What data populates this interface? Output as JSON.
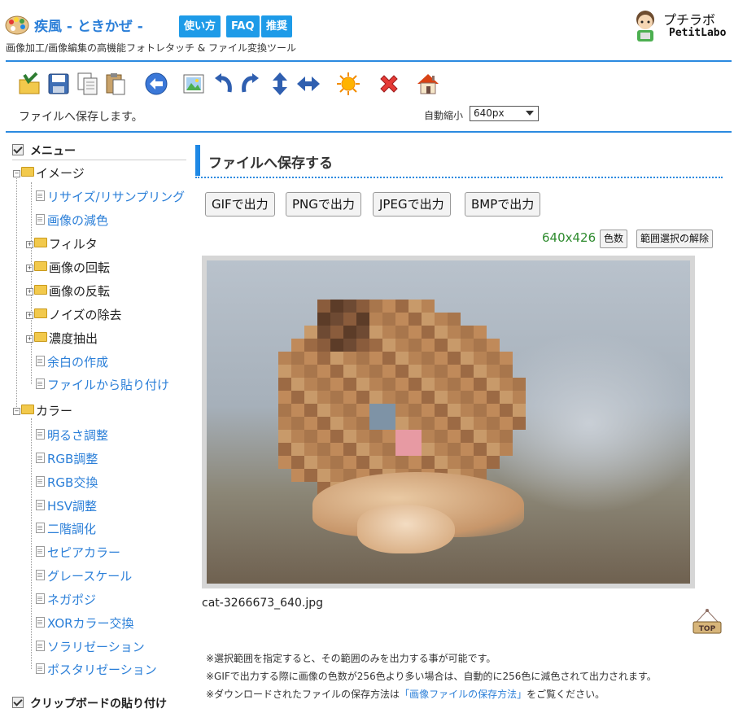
{
  "header": {
    "title": "疾風 - ときかぜ -",
    "buttons": [
      "使い方",
      "FAQ",
      "推奨"
    ],
    "subtitle": "画像加工/画像編集の高機能フォトレタッチ & ファイル変換ツール",
    "brand_line1": "プチラボ",
    "brand_line2": "PetitLabo"
  },
  "toolbar": {
    "icons": [
      "open-file-icon",
      "save-disk-icon",
      "copy-icon",
      "paste-icon",
      "back-arrow-icon",
      "image-icon",
      "rotate-left-icon",
      "rotate-right-icon",
      "flip-vertical-icon",
      "flip-horizontal-icon",
      "sun-icon",
      "delete-x-icon",
      "home-icon"
    ],
    "status": "ファイルへ保存します。",
    "shrink_label": "自動縮小",
    "shrink_value": "640px"
  },
  "sidebar": {
    "menu_title": "メニュー",
    "image_folder": "イメージ",
    "image_items": {
      "resize": "リサイズ/リサンプリング",
      "reduce": "画像の減色",
      "filter": "フィルタ",
      "rotate": "画像の回転",
      "flip": "画像の反転",
      "noise": "ノイズの除去",
      "density": "濃度抽出",
      "margin": "余白の作成",
      "paste_file": "ファイルから貼り付け"
    },
    "color_folder": "カラー",
    "color_items": [
      "明るさ調整",
      "RGB調整",
      "RGB交換",
      "HSV調整",
      "二階調化",
      "セピアカラー",
      "グレースケール",
      "ネガポジ",
      "XORカラー交換",
      "ソラリゼーション",
      "ポスタリゼーション"
    ],
    "clipboard_title": "クリップボードの貼り付け"
  },
  "main": {
    "section_title": "ファイルへ保存する",
    "output_buttons": [
      "GIFで出力",
      "PNGで出力",
      "JPEGで出力",
      "BMPで出力"
    ],
    "dimensions": "640x426",
    "colors_button": "色数",
    "clear_selection_button": "範囲選択の解除",
    "filename": "cat-3266673_640.jpg",
    "top_label": "TOP",
    "notes": [
      "※選択範囲を指定すると、その範囲のみを出力する事が可能です。",
      "※GIFで出力する際に画像の色数が256色より多い場合は、自動的に256色に減色されて出力されます。"
    ],
    "note3_prefix": "※ダウンロードされたファイルの保存方法は",
    "note3_link": "「画像ファイルの保存方法」",
    "note3_suffix": "をご覧ください。"
  },
  "colors": {
    "accent": "#2b8ae0",
    "link": "#2b7fd8",
    "header_button": "#1e9be8",
    "dimension_text": "#2e8b2e"
  }
}
